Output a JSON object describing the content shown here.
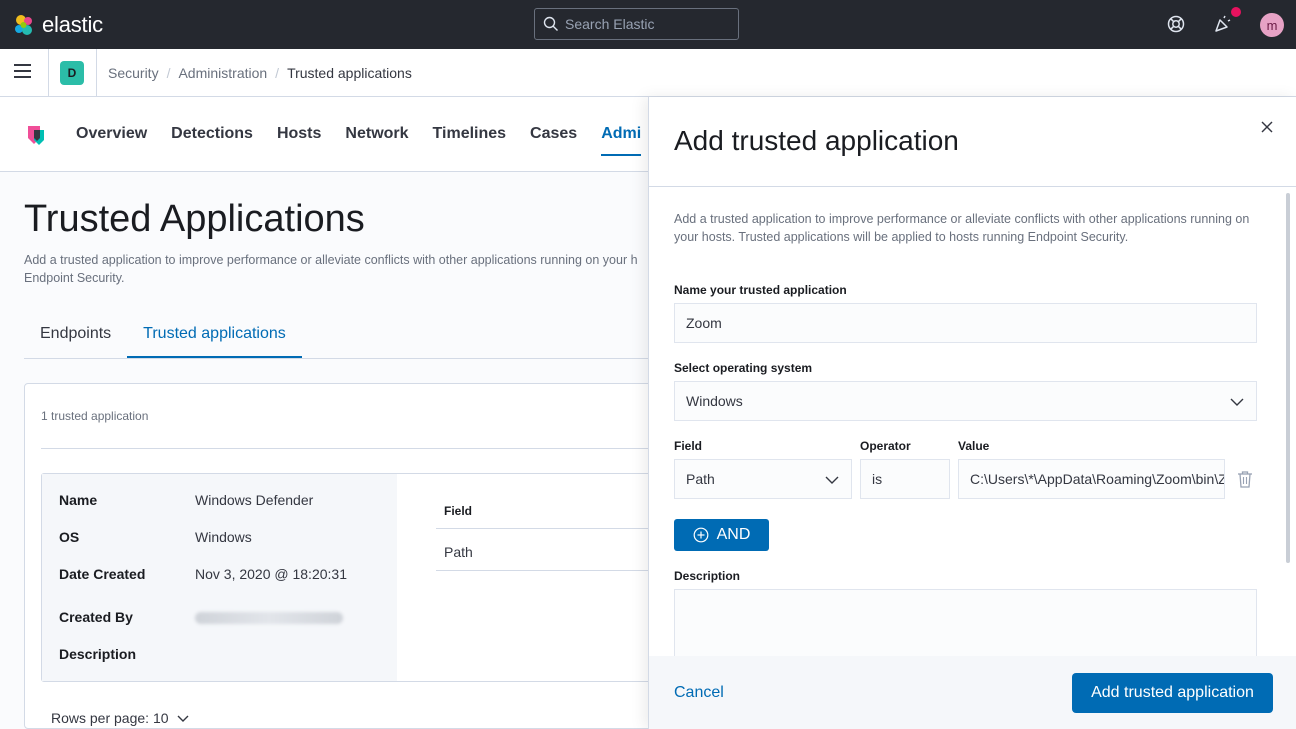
{
  "header": {
    "brand": "elastic",
    "search_placeholder": "Search Elastic",
    "avatar_initial": "m",
    "notification_color": "#e7125f"
  },
  "breadcrumb": {
    "space_initial": "D",
    "items": [
      "Security",
      "Administration",
      "Trusted applications"
    ]
  },
  "nav": {
    "tabs": [
      "Overview",
      "Detections",
      "Hosts",
      "Network",
      "Timelines",
      "Cases",
      "Admi"
    ],
    "active_tab": "Administration"
  },
  "page": {
    "title": "Trusted Applications",
    "description_line1": "Add a trusted application to improve performance or alleviate conflicts with other applications running on your h",
    "description_line2": "Endpoint Security.",
    "tabs": [
      "Endpoints",
      "Trusted applications"
    ],
    "count_text": "1 trusted application",
    "card": {
      "name_label": "Name",
      "name_value": "Windows Defender",
      "os_label": "OS",
      "os_value": "Windows",
      "date_label": "Date Created",
      "date_value": "Nov 3, 2020 @ 18:20:31",
      "created_by_label": "Created By",
      "description_label": "Description",
      "entries_header": "Field",
      "entries_value": "Path"
    },
    "rows_per_page": "Rows per page: 10"
  },
  "flyout": {
    "title": "Add trusted application",
    "description": "Add a trusted application to improve performance or alleviate conflicts with other applications running on your hosts. Trusted applications will be applied to hosts running Endpoint Security.",
    "name_label": "Name your trusted application",
    "name_value": "Zoom",
    "os_label": "Select operating system",
    "os_value": "Windows",
    "field_label": "Field",
    "field_value": "Path",
    "operator_label": "Operator",
    "operator_value": "is",
    "value_label": "Value",
    "value_value": "C:\\Users\\*\\AppData\\Roaming\\Zoom\\bin\\Zoom.exe",
    "and_button": "AND",
    "description_label": "Description",
    "cancel_label": "Cancel",
    "submit_label": "Add trusted application"
  },
  "colors": {
    "primary": "#006bb4",
    "header_bg": "#25282f",
    "space_badge": "#2bbda8",
    "avatar_bg": "#e7a2c5"
  }
}
